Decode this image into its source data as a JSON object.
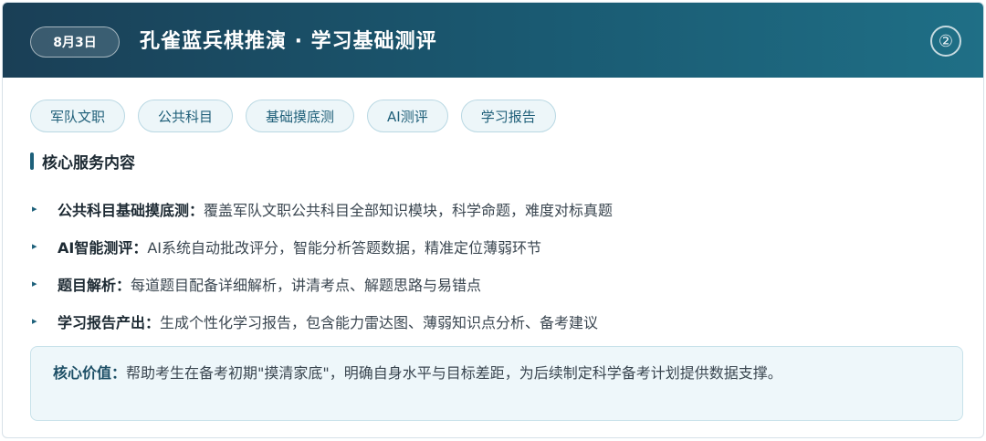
{
  "header": {
    "date": "8月3日",
    "title": "孔雀蓝兵棋推演 · 学习基础测评",
    "number_badge": "②"
  },
  "tags": [
    "军队文职",
    "公共科目",
    "基础摸底测",
    "AI测评",
    "学习报告"
  ],
  "section": {
    "title": "核心服务内容"
  },
  "bullets": [
    {
      "key": "公共科目基础摸底测：",
      "text": "覆盖军队文职公共科目全部知识模块，科学命题，难度对标真题"
    },
    {
      "key": "AI智能测评：",
      "text": "AI系统自动批改评分，智能分析答题数据，精准定位薄弱环节"
    },
    {
      "key": "题目解析：",
      "text": "每道题目配备详细解析，讲清考点、解题思路与易错点"
    },
    {
      "key": "学习报告产出：",
      "text": "生成个性化学习报告，包含能力雷达图、薄弱知识点分析、备考建议"
    }
  ],
  "value": {
    "key": "核心价值：",
    "text": "帮助考生在备考初期\"摸清家底\"，明确自身水平与目标差距，为后续制定科学备考计划提供数据支撑。"
  },
  "colors": {
    "header_start": "#1a3f56",
    "header_end": "#1f6f86",
    "accent": "#1d607a",
    "tag_bg": "#edf6f9"
  }
}
